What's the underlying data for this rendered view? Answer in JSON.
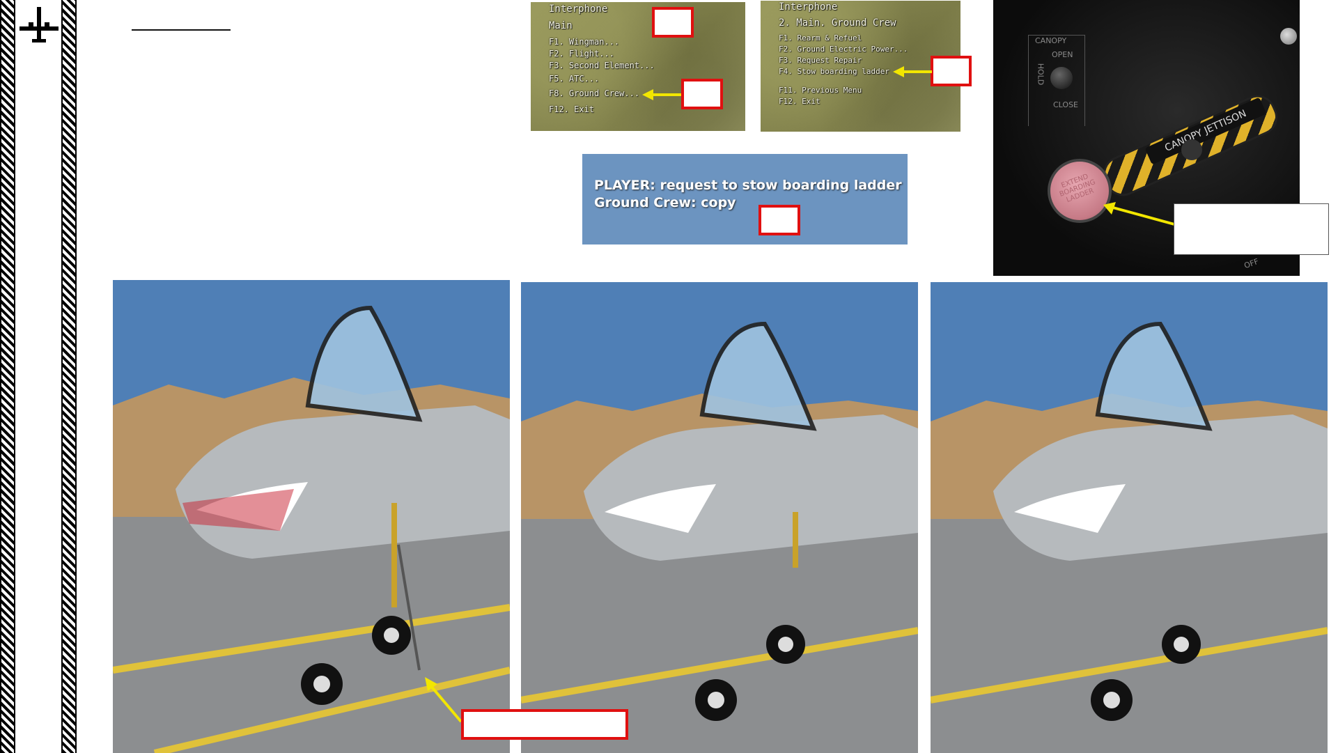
{
  "sidebar": {
    "icon": "aircraft-silhouette-icon"
  },
  "menu_main": {
    "title": "Interphone",
    "subtitle": "Main",
    "items": [
      "F1. Wingman...",
      "F2. Flight...",
      "F3. Second Element...",
      "F5. ATC...",
      "F8. Ground Crew...",
      "F12. Exit"
    ]
  },
  "menu_ground": {
    "title": "Interphone",
    "subtitle": "2. Main. Ground Crew",
    "items": [
      "F1. Rearm & Refuel",
      "F2. Ground Electric Power...",
      "F3. Request Repair",
      "F4. Stow boarding ladder"
    ],
    "footer": [
      "F11. Previous Menu",
      "F12. Exit"
    ]
  },
  "message": {
    "line1": "PLAYER: request to stow boarding ladder",
    "line2": "Ground Crew: copy"
  },
  "cockpit": {
    "canopy_label": "CANOPY",
    "open_label": "OPEN",
    "hold_label": "HOLD",
    "close_label": "CLOSE",
    "jettison_label": "CANOPY JETTISON",
    "button_label": "EXTEND BOARDING LADDER",
    "off_label": "OFF"
  },
  "colors": {
    "highlight_arrow": "#f2e600",
    "callout_border": "#e01010",
    "message_bg": "#6c94c0"
  }
}
